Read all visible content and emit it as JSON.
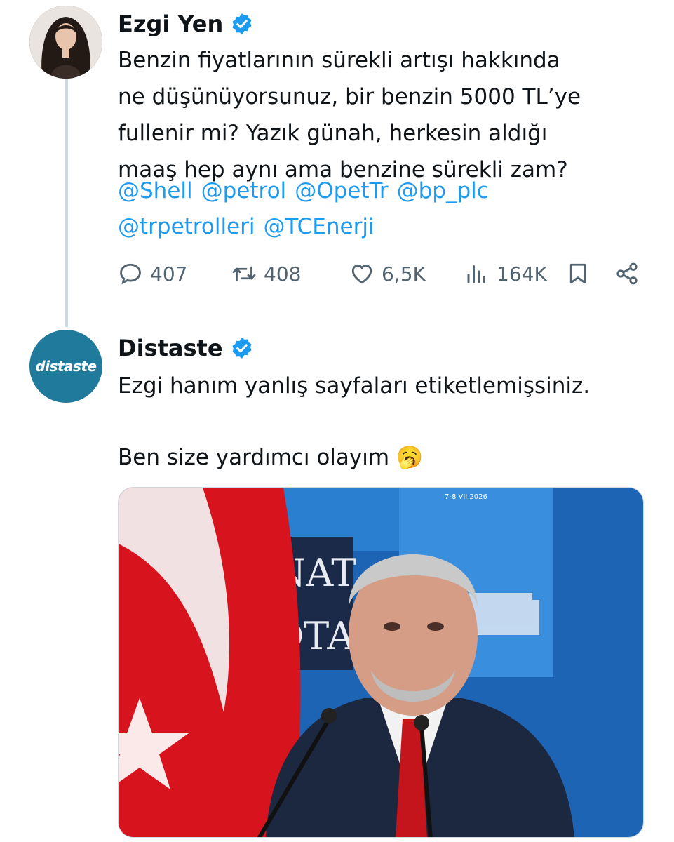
{
  "tweets": [
    {
      "author": "Ezgi Yen",
      "verified": true,
      "text": "Benzin fiyatlarının sürekli artışı hakkında\nne düşünüyorsunuz, bir benzin 5000 TL’ye\nfullenir mi? Yazık günah, herkesin aldığı\nmaaş hep aynı ama benzine sürekli zam?",
      "mentions_line1": [
        "@Shell",
        "@petrol",
        "@OpetTr",
        "@bp_plc"
      ],
      "mentions_line2": [
        "@trpetrolleri",
        "@TCEnerji"
      ],
      "stats": {
        "replies": "407",
        "retweets": "408",
        "likes": "6,5K",
        "views": "164K"
      }
    },
    {
      "author": "Distaste",
      "avatar_text": "distaste",
      "verified": true,
      "text_line1": "Ezgi hanım yanlış sayfaları etiketlemişsiniz.",
      "text_line2": "Ben size yardımcı olayım 🥱",
      "media_caption": "7-8 VII 2026",
      "media_sign_text": "NAT\nOTA"
    }
  ],
  "colors": {
    "link": "#1d9bf0",
    "muted": "#536471",
    "verified": "#1d9bf0"
  },
  "icons": [
    "reply-icon",
    "retweet-icon",
    "like-icon",
    "views-icon",
    "bookmark-icon",
    "share-icon",
    "verified-badge-icon"
  ]
}
